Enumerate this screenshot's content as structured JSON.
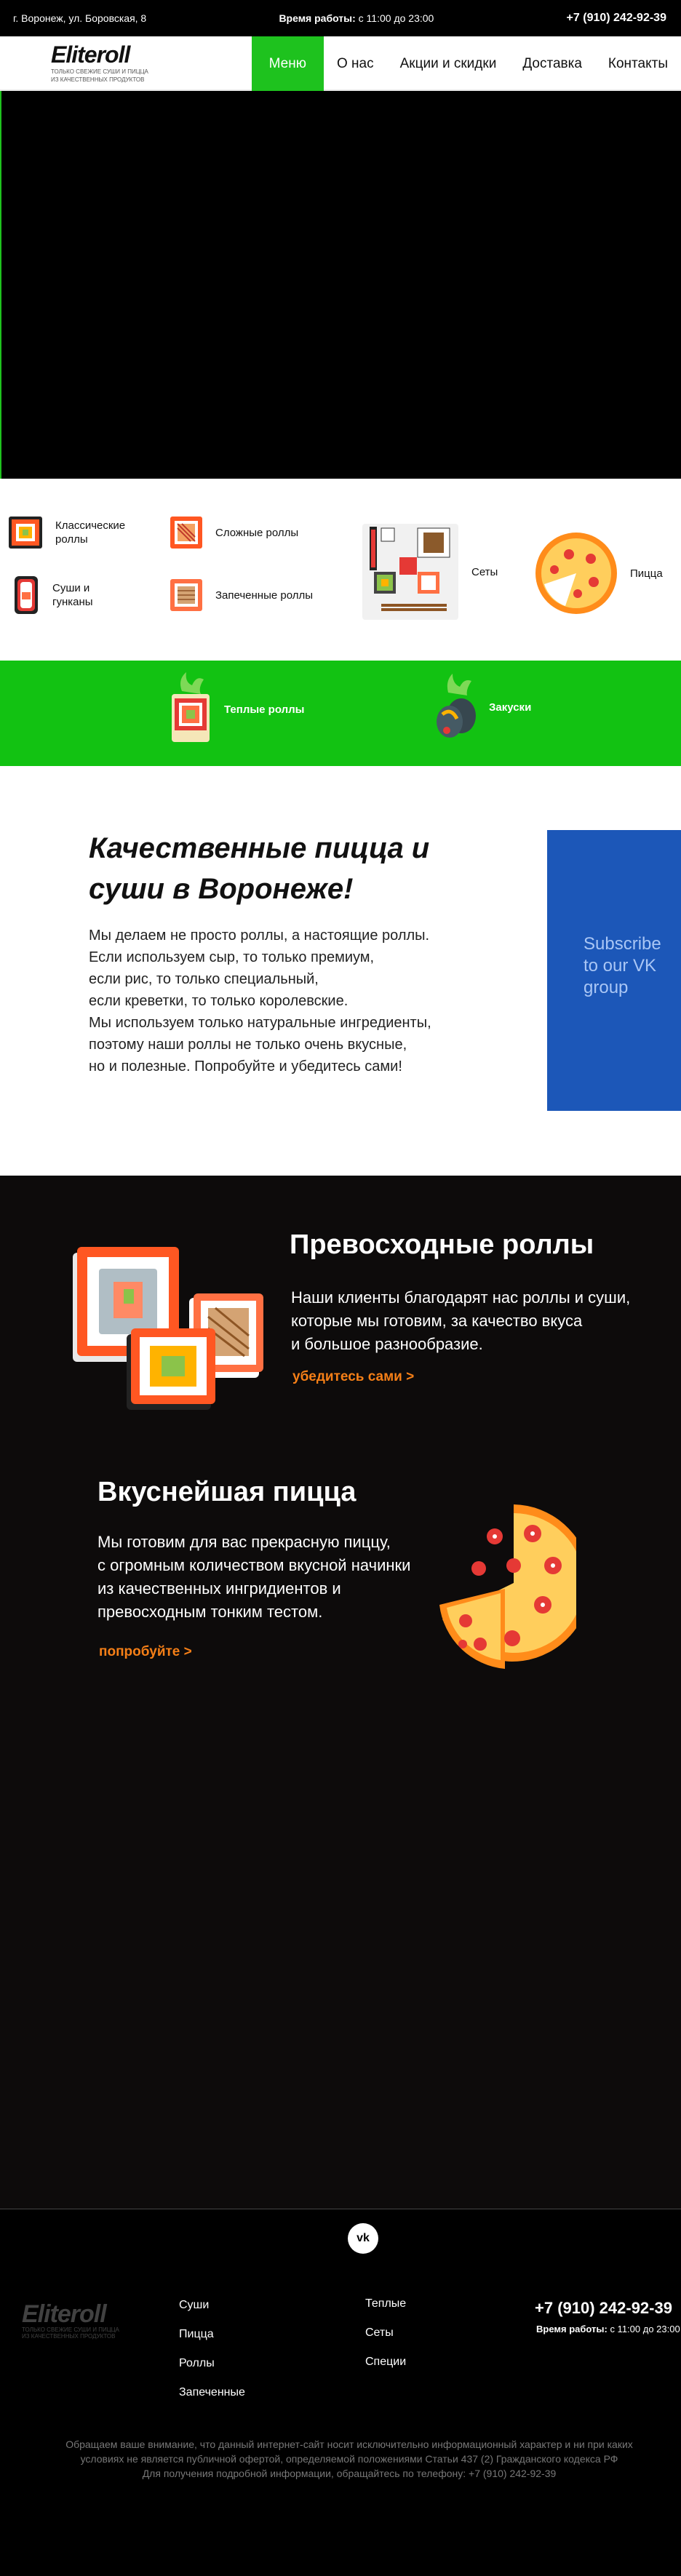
{
  "topbar": {
    "address": "г. Воронеж, ул. Боровская, 8",
    "hours_label": "Время работы:",
    "hours_value": " с 11:00 до 23:00",
    "phone": "+7 (910) 242-92-39"
  },
  "header": {
    "logo_text": "Eliteroll",
    "logo_tagline_1": "только свежие суши и пицца",
    "logo_tagline_2": "из качественных продуктов",
    "nav": [
      "Меню",
      "О нас",
      "Акции и скидки",
      "Доставка",
      "Контакты"
    ]
  },
  "categories": {
    "classic": "Классические роллы",
    "complex": "Сложные роллы",
    "sushi": "Суши и гунканы",
    "baked": "Запеченные роллы",
    "sets": "Сеты",
    "pizza": "Пицца",
    "warm": "Теплые роллы",
    "snacks": "Закуски"
  },
  "about": {
    "title": "Качественные пицца и суши в Воронеже!",
    "lines": [
      "Мы делаем не просто роллы, а настоящие роллы.",
      "Если используем сыр, то только премиум,",
      "если рис, то только специальный,",
      "если креветки, то только королевские.",
      "Мы используем только натуральные ингредиенты,",
      "поэтому наши роллы не только очень вкусные,",
      "но и полезные. Попробуйте и убедитесь сами!"
    ],
    "vk_widget": "Subscribe to our VK group"
  },
  "promo": {
    "rolls_title": "Превосходные роллы",
    "rolls_text": [
      "Наши клиенты благодарят нас роллы и суши,",
      "которые мы готовим, за качество вкуса",
      "и большое разнообразие."
    ],
    "rolls_link": "убедитесь сами >",
    "pizza_title": "Вкуснейшая пицца",
    "pizza_text": [
      "Мы готовим для вас прекрасную пиццу,",
      "с огромным количеством вкусной начинки",
      "из качественных ингридиентов и",
      "превосходным тонким тестом."
    ],
    "pizza_link": "попробуйте >"
  },
  "footer": {
    "vk": "vk",
    "logo_text": "Eliteroll",
    "logo_tagline_1": "только свежие суши и пицца",
    "logo_tagline_2": "из качественных продуктов",
    "col1": [
      "Суши",
      "Пицца",
      "Роллы",
      "Запеченные"
    ],
    "col2": [
      "Теплые",
      "Сеты",
      "Специи"
    ],
    "phone": "+7 (910) 242-92-39",
    "hours_label": "Время работы:",
    "hours_value": " с 11:00 до 23:00",
    "notice": [
      "Обращаем ваше внимание, что данный интернет-сайт носит исключительно информационный характер и ни при каких",
      "условиях не является публичной офертой, определяемой положениями Статьи 437 (2) Гражданского кодекса РФ",
      "Для получения подробной информации, обращайтесь по телефону: +7 (910) 242-92-39"
    ]
  },
  "colors": {
    "accent_green": "#1ec21e",
    "link_orange": "#f57f17",
    "vk_blue": "#1c57b8"
  }
}
